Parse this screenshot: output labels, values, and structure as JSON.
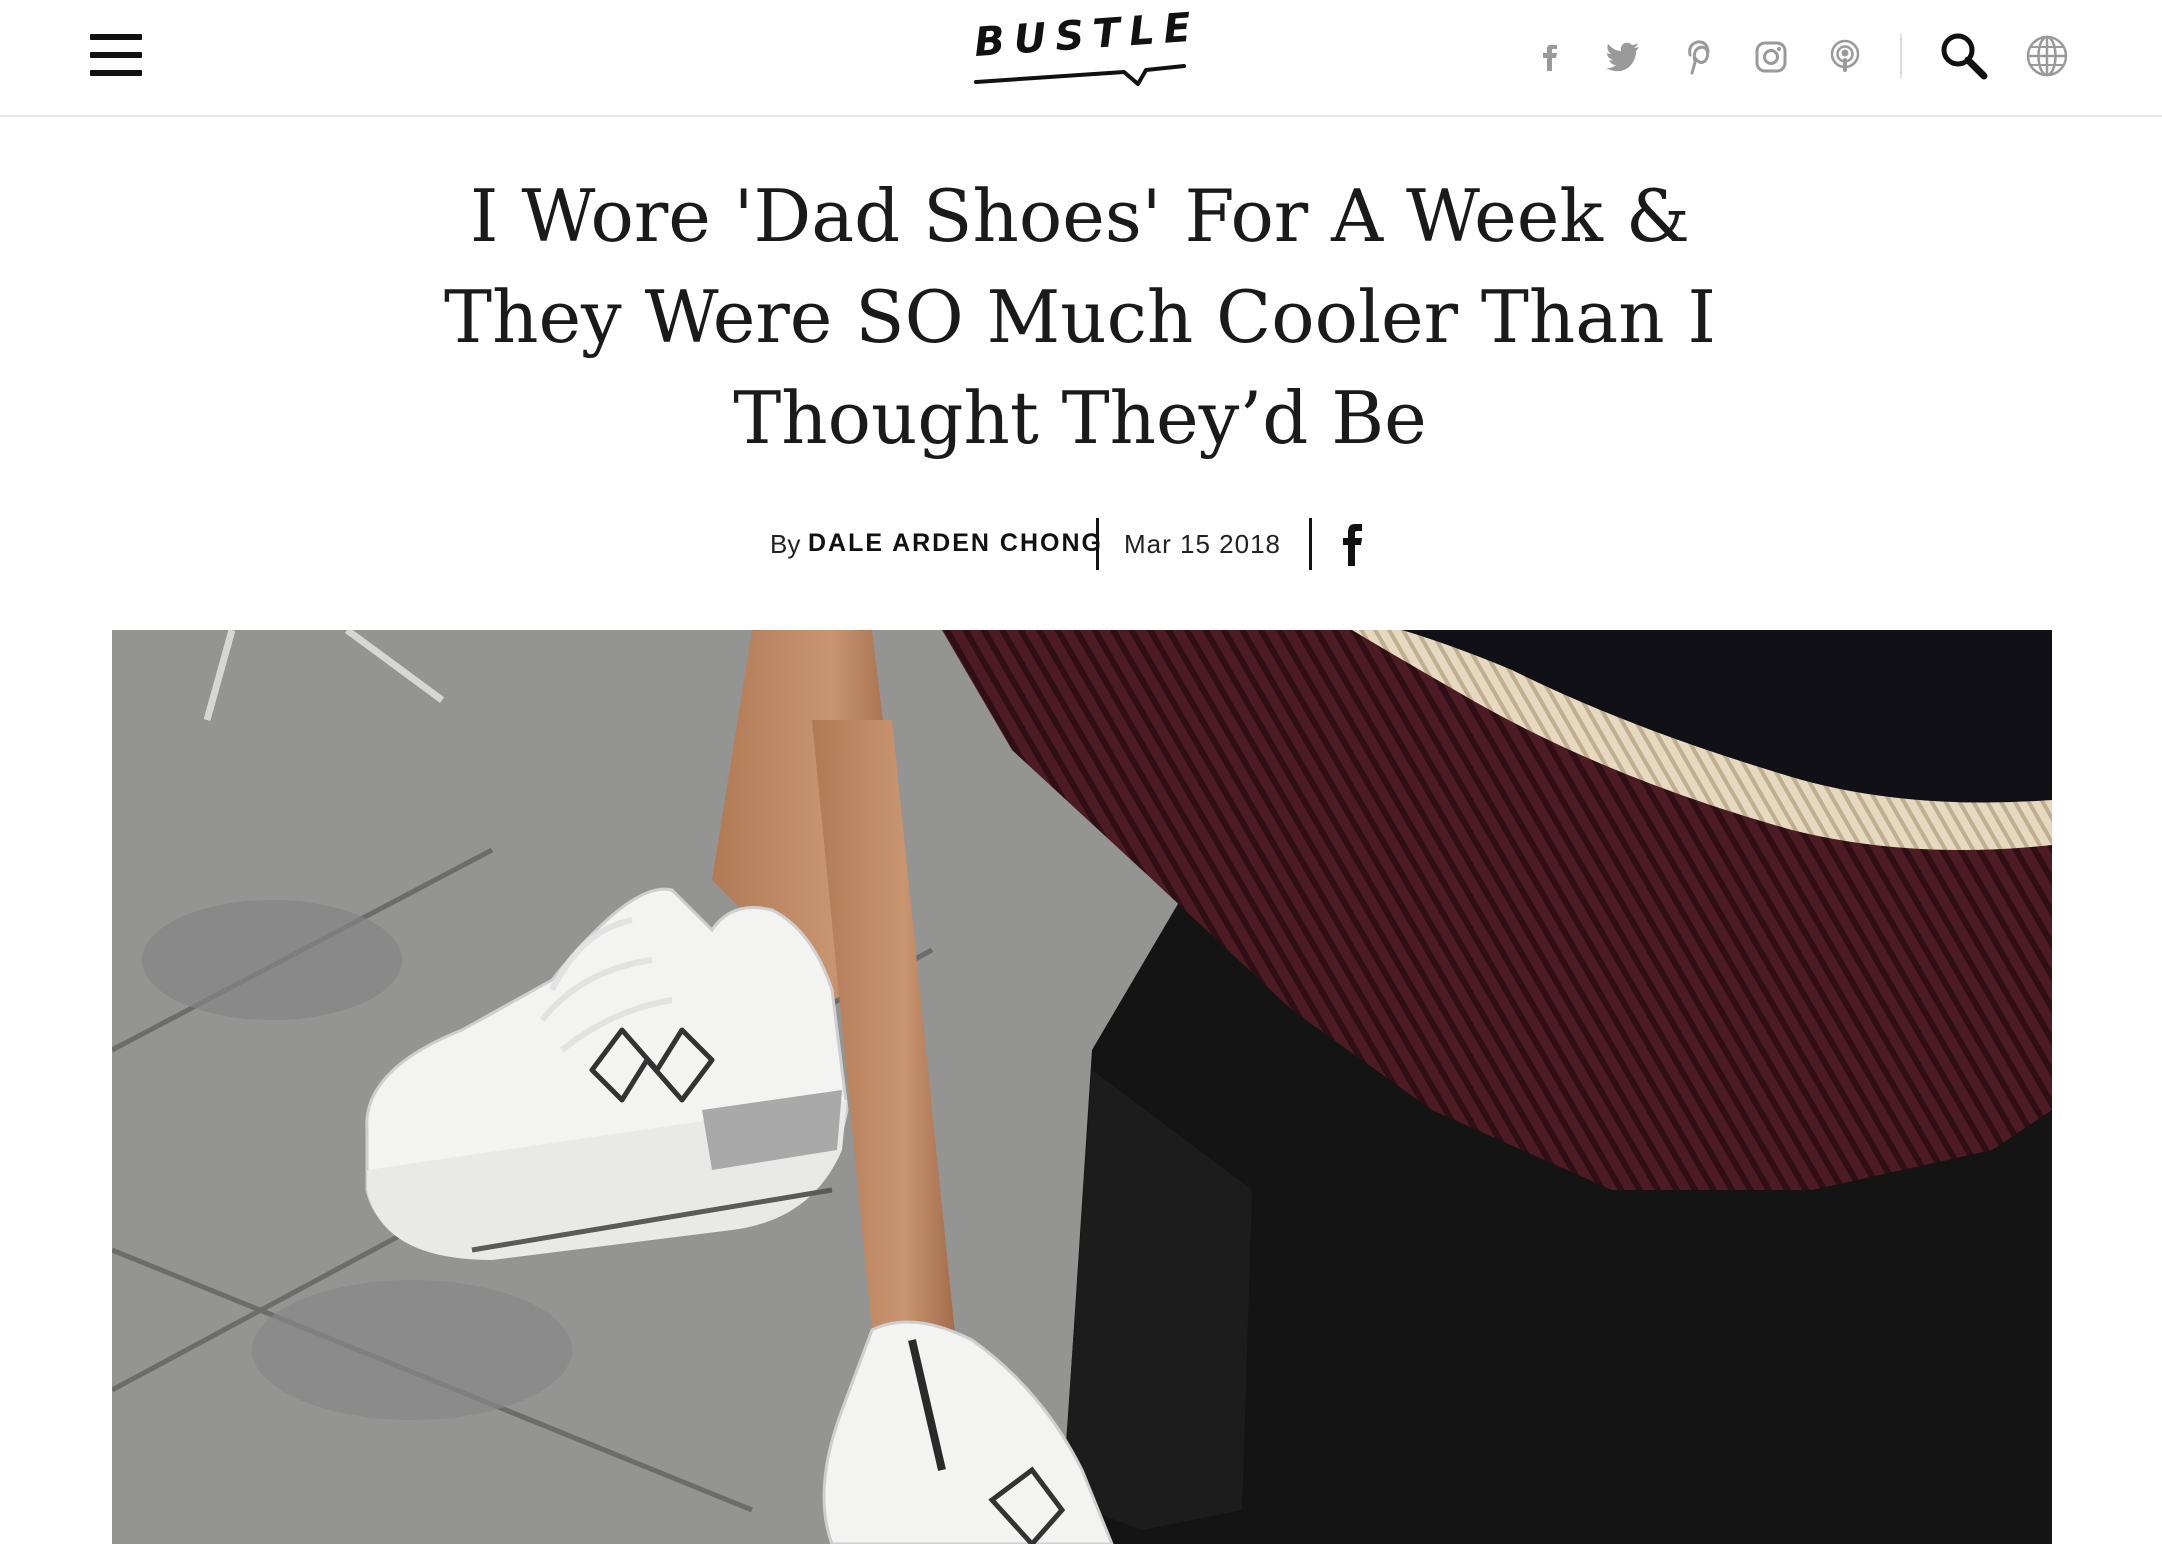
{
  "header": {
    "logo_text": "BUSTLE",
    "menu_icon": "hamburger-menu-icon",
    "social_icons": [
      "facebook-icon",
      "twitter-icon",
      "pinterest-icon",
      "instagram-icon",
      "podcast-icon"
    ],
    "search_icon": "search-icon",
    "globe_icon": "globe-icon",
    "icon_color": "#9a9a9a"
  },
  "article": {
    "title": "I Wore 'Dad Shoes' For A Week & They Were SO Much Cooler Than I Thought They’d Be",
    "byline_prefix": "By",
    "author": "DALE ARDEN CHONG",
    "date": "Mar 15 2018",
    "share_icon": "facebook-share-icon"
  },
  "hero_image": {
    "subject": "white-sneakers-photo",
    "colors": {
      "sidewalk": "#8f8f8e",
      "skirt": "#4a1a22",
      "stripe": "#e3d6bc",
      "pants": "#141414",
      "shoe": "#f2f2f2"
    }
  }
}
